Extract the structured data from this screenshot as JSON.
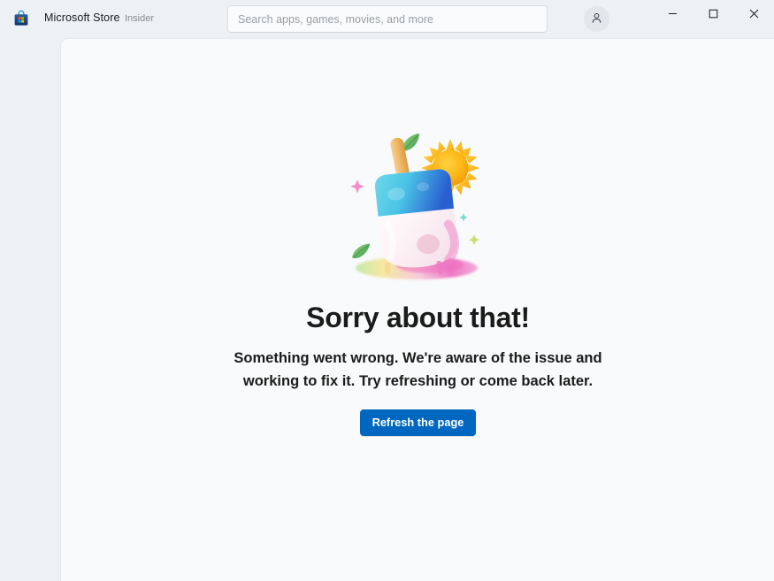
{
  "window": {
    "app_title": "Microsoft Store",
    "channel_badge": "Insider",
    "app_icon": "microsoft-store-bag-icon",
    "controls": {
      "minimize": "minimize-icon",
      "maximize": "maximize-icon",
      "close": "close-icon"
    }
  },
  "search": {
    "placeholder": "Search apps, games, movies, and more",
    "value": "",
    "icon": "search-icon"
  },
  "account": {
    "icon": "person-icon",
    "label": "Account"
  },
  "error": {
    "illustration": "melting-popsicle-illustration",
    "title": "Sorry about that!",
    "body": "Something went wrong. We're aware of the issue and working to fix it. Try refreshing or come back later.",
    "button_label": "Refresh the page"
  },
  "colors": {
    "titlebar_bg": "#eef1f4",
    "content_bg": "#f9fafb",
    "accent": "#0067c0",
    "text_primary": "#1b1b1b",
    "text_muted": "#848a90"
  }
}
